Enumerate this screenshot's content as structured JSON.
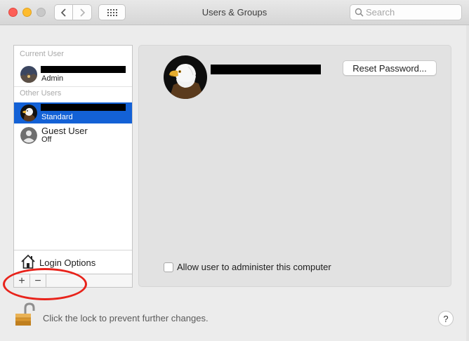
{
  "window": {
    "title": "Users & Groups",
    "search_placeholder": "Search"
  },
  "sidebar": {
    "current_user_header": "Current User",
    "other_users_header": "Other Users",
    "current_user": {
      "role": "Admin"
    },
    "other_users": [
      {
        "role": "Standard",
        "selected": true
      },
      {
        "name": "Guest User",
        "role": "Off"
      }
    ],
    "login_options_label": "Login Options",
    "add_label": "+",
    "remove_label": "−"
  },
  "detail": {
    "reset_password_label": "Reset Password...",
    "admin_checkbox_label": "Allow user to administer this computer",
    "admin_checked": false
  },
  "footer": {
    "lock_text": "Click the lock to prevent further changes.",
    "help_label": "?"
  },
  "colors": {
    "selection": "#1361d6",
    "annotation": "#e8231b"
  },
  "icons": [
    "eagle-avatar-icon",
    "guest-avatar-icon",
    "house-icon",
    "lock-icon",
    "search-icon",
    "grid-icon"
  ]
}
